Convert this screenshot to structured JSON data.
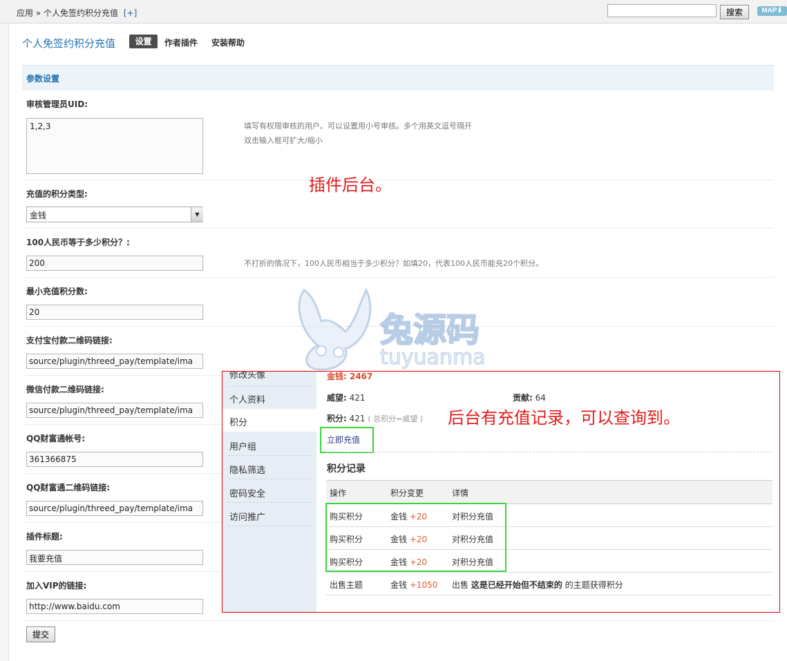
{
  "breadcrumb": {
    "root": "应用",
    "sep": "»",
    "current": "个人免签约积分充值",
    "add": "[+]"
  },
  "search": {
    "button": "搜索",
    "value": ""
  },
  "map_label": "MAP",
  "plugin": {
    "title": "个人免签约积分充值",
    "tabs": [
      "设置",
      "作者插件",
      "安装帮助"
    ]
  },
  "section_title": "参数设置",
  "fields": {
    "uid": {
      "label": "审核管理员UID:",
      "value": "1,2,3",
      "tip1": "填写有权限审核的用户。可以设置用小号审核。多个用英文逗号隔开",
      "tip2": "双击输入框可扩大/缩小"
    },
    "credit_type": {
      "label": "充值的积分类型:",
      "value": "金钱"
    },
    "rate": {
      "label": "100人民币等于多少积分？:",
      "value": "200",
      "tip": "不打折的情况下，100人民币相当于多少积分？如填20，代表100人民币能充20个积分。"
    },
    "min": {
      "label": "最小充值积分数:",
      "value": "20"
    },
    "alipay": {
      "label": "支付宝付款二维码链接:",
      "value": "source/plugin/threed_pay/template/ima"
    },
    "wechat": {
      "label": "微信付款二维码链接:",
      "value": "source/plugin/threed_pay/template/ima"
    },
    "qq_account": {
      "label": "QQ财富通帐号:",
      "value": "361366875"
    },
    "qq_qr": {
      "label": "QQ财富通二维码链接:",
      "value": "source/plugin/threed_pay/template/ima"
    },
    "plugin_title": {
      "label": "插件标题:",
      "value": "我要充值"
    },
    "vip_link": {
      "label": "加入VIP的链接:",
      "value": "http://www.baidu.com"
    }
  },
  "submit": "提交",
  "annotations": {
    "backend": "插件后台。",
    "records": "后台有充值记录，可以查询到。"
  },
  "watermark": {
    "cn": "兔源码",
    "en": "tuyuanma"
  },
  "overlay": {
    "sidebar": [
      "修改头像",
      "个人资料",
      "积分",
      "用户组",
      "隐私筛选",
      "密码安全",
      "访问推广"
    ],
    "money": "金钱: 2467",
    "prestige_label": "威望:",
    "prestige": "421",
    "contrib_label": "贡献:",
    "contrib": "64",
    "credits_label": "积分:",
    "credits": "421",
    "credits_note": "( 总积分=威望 )",
    "recharge_link": "立即充值",
    "records_title": "积分记录",
    "columns": [
      "操作",
      "积分变更",
      "详情"
    ],
    "rows": [
      {
        "op": "购买积分",
        "type": "金钱",
        "delta": "+20",
        "detail": "对积分充值",
        "bold": ""
      },
      {
        "op": "购买积分",
        "type": "金钱",
        "delta": "+20",
        "detail": "对积分充值",
        "bold": ""
      },
      {
        "op": "购买积分",
        "type": "金钱",
        "delta": "+20",
        "detail": "对积分充值",
        "bold": ""
      },
      {
        "op": "出售主题",
        "type": "金钱",
        "delta": "+1050",
        "detail": "出售",
        "bold": "这是已经开始但不结束的",
        "suffix": "的主题获得积分"
      }
    ]
  }
}
